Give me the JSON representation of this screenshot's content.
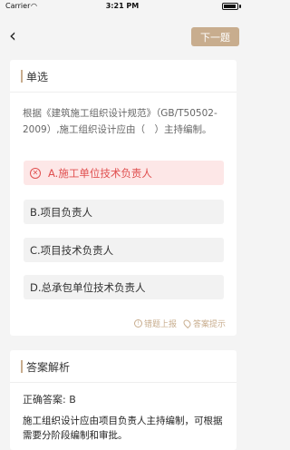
{
  "status": {
    "carrier": "Carrier",
    "time": "3:21 PM"
  },
  "nav": {
    "back_icon": "chevron-left-icon",
    "next_label": "下一题"
  },
  "question_card": {
    "section_title": "单选",
    "question_text": "根据《建筑施工组织设计规范》（GB/T50502-2009）,施工组织设计应由（　）主持编制。",
    "options": [
      {
        "label": "A.施工单位技术负责人",
        "state": "wrong"
      },
      {
        "label": "B.项目负责人",
        "state": "normal"
      },
      {
        "label": "C.项目技术负责人",
        "state": "normal"
      },
      {
        "label": "D.总承包单位技术负责人",
        "state": "normal"
      }
    ],
    "report_label": "错题上报",
    "hint_label": "答案提示"
  },
  "answer_card": {
    "section_title": "答案解析",
    "correct_answer": "正确答案: B",
    "explanation": "施工组织设计应由项目负责人主持编制，可根据需要分阶段编制和审批。"
  },
  "colors": {
    "accent": "#c8ad8e",
    "wrong": "#e05050",
    "wrong_bg": "#fde7e7"
  }
}
